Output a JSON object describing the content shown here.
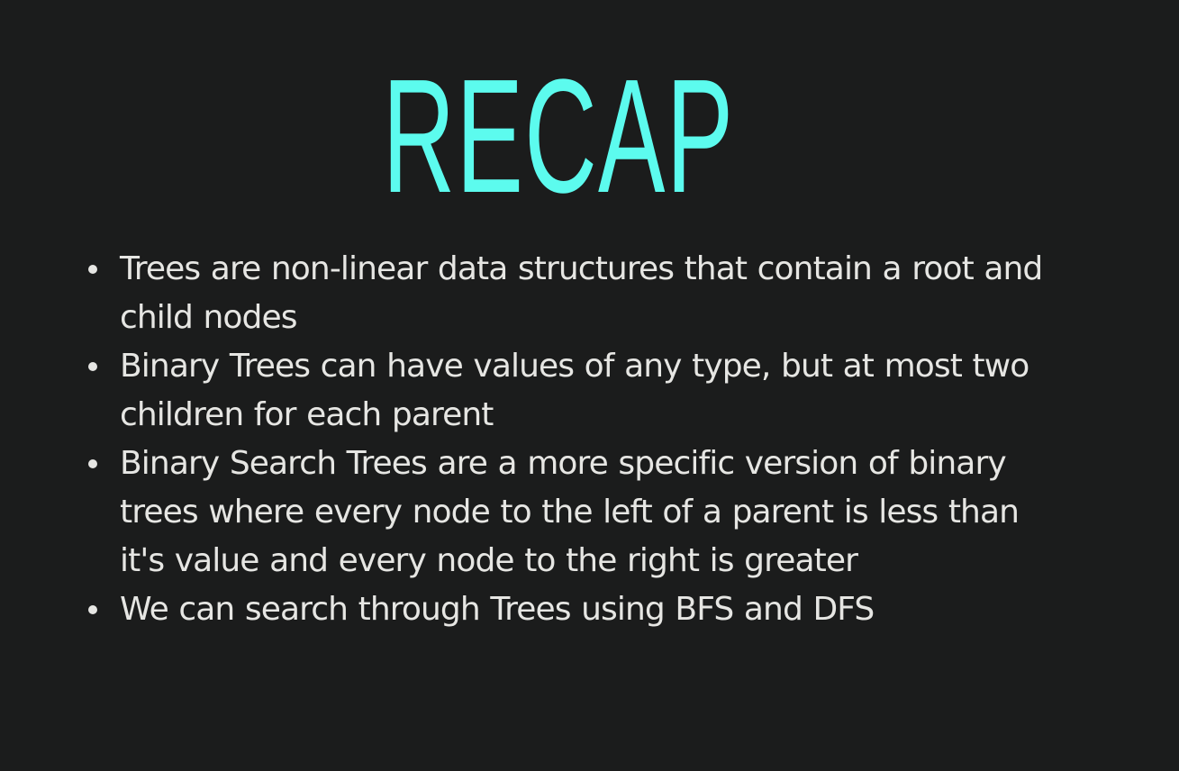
{
  "slide": {
    "title": "RECAP",
    "bullets": [
      "Trees are non-linear data structures that contain a root and child nodes",
      "Binary Trees can have values of any type, but at most two children for each parent",
      "Binary Search Trees are a more specific version of binary trees where every node to the left of a parent is less than it's value and every node to the right is greater",
      "We can search through Trees using BFS and DFS"
    ]
  },
  "colors": {
    "background": "#1b1c1c",
    "title": "#5cfbee",
    "text": "#e6e6e3",
    "bullet_dot": "#e6e6e3"
  }
}
